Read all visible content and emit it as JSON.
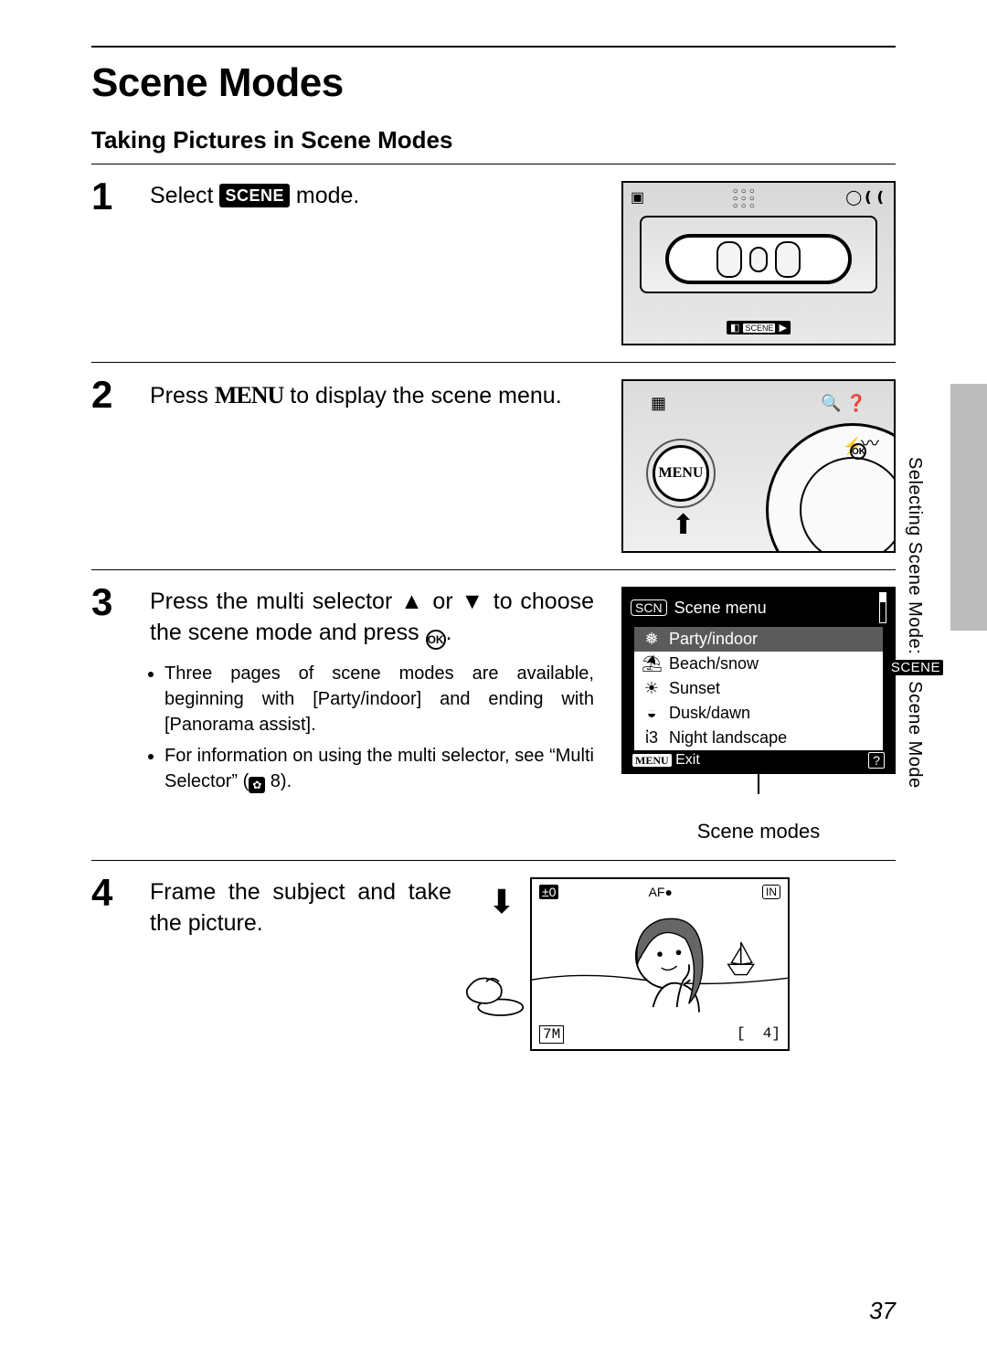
{
  "page": {
    "title": "Scene Modes",
    "subtitle": "Taking Pictures in Scene Modes",
    "number": "37"
  },
  "side_label": {
    "prefix": "Selecting Scene Mode: ",
    "badge": "SCENE",
    "suffix": " Scene Mode"
  },
  "steps": {
    "s1": {
      "num": "1",
      "pre": "Select ",
      "badge": "SCENE",
      "post": " mode."
    },
    "s2": {
      "num": "2",
      "pre": "Press ",
      "menu_word": "MENU",
      "post": " to display the scene menu."
    },
    "s3": {
      "num": "3",
      "line_a": "Press the multi selector ",
      "or": " or ",
      "line_b": " to choose the scene mode and press ",
      "ok": "OK",
      "period": ".",
      "bullets": [
        "Three pages of scene modes are available, beginning with [Party/indoor] and ending with [Panorama assist].",
        "For information on using the multi selector, see “Multi Selector” ("
      ],
      "bullet2_ref_num": " 8).",
      "caption": "Scene modes"
    },
    "s4": {
      "num": "4",
      "text": "Frame the subject and take the picture."
    }
  },
  "scene_menu": {
    "scn": "SCN",
    "title": "Scene menu",
    "items": [
      {
        "icon": "❅",
        "label": "Party/indoor",
        "sel": true
      },
      {
        "icon": "⛱",
        "label": "Beach/snow",
        "sel": false
      },
      {
        "icon": "☀",
        "label": "Sunset",
        "sel": false
      },
      {
        "icon": "◒",
        "label": "Dusk/dawn",
        "sel": false
      },
      {
        "icon": "ἰ3",
        "label": "Night landscape",
        "sel": false
      }
    ],
    "exit_badge": "MENU",
    "exit": "Exit",
    "help": "?"
  },
  "illus1": {
    "badge": "SCENE"
  },
  "illus2": {
    "menu": "MENU",
    "ok": "OK"
  },
  "illus4": {
    "af": "AF",
    "in": "IN",
    "shots": "4",
    "size": "7M"
  }
}
